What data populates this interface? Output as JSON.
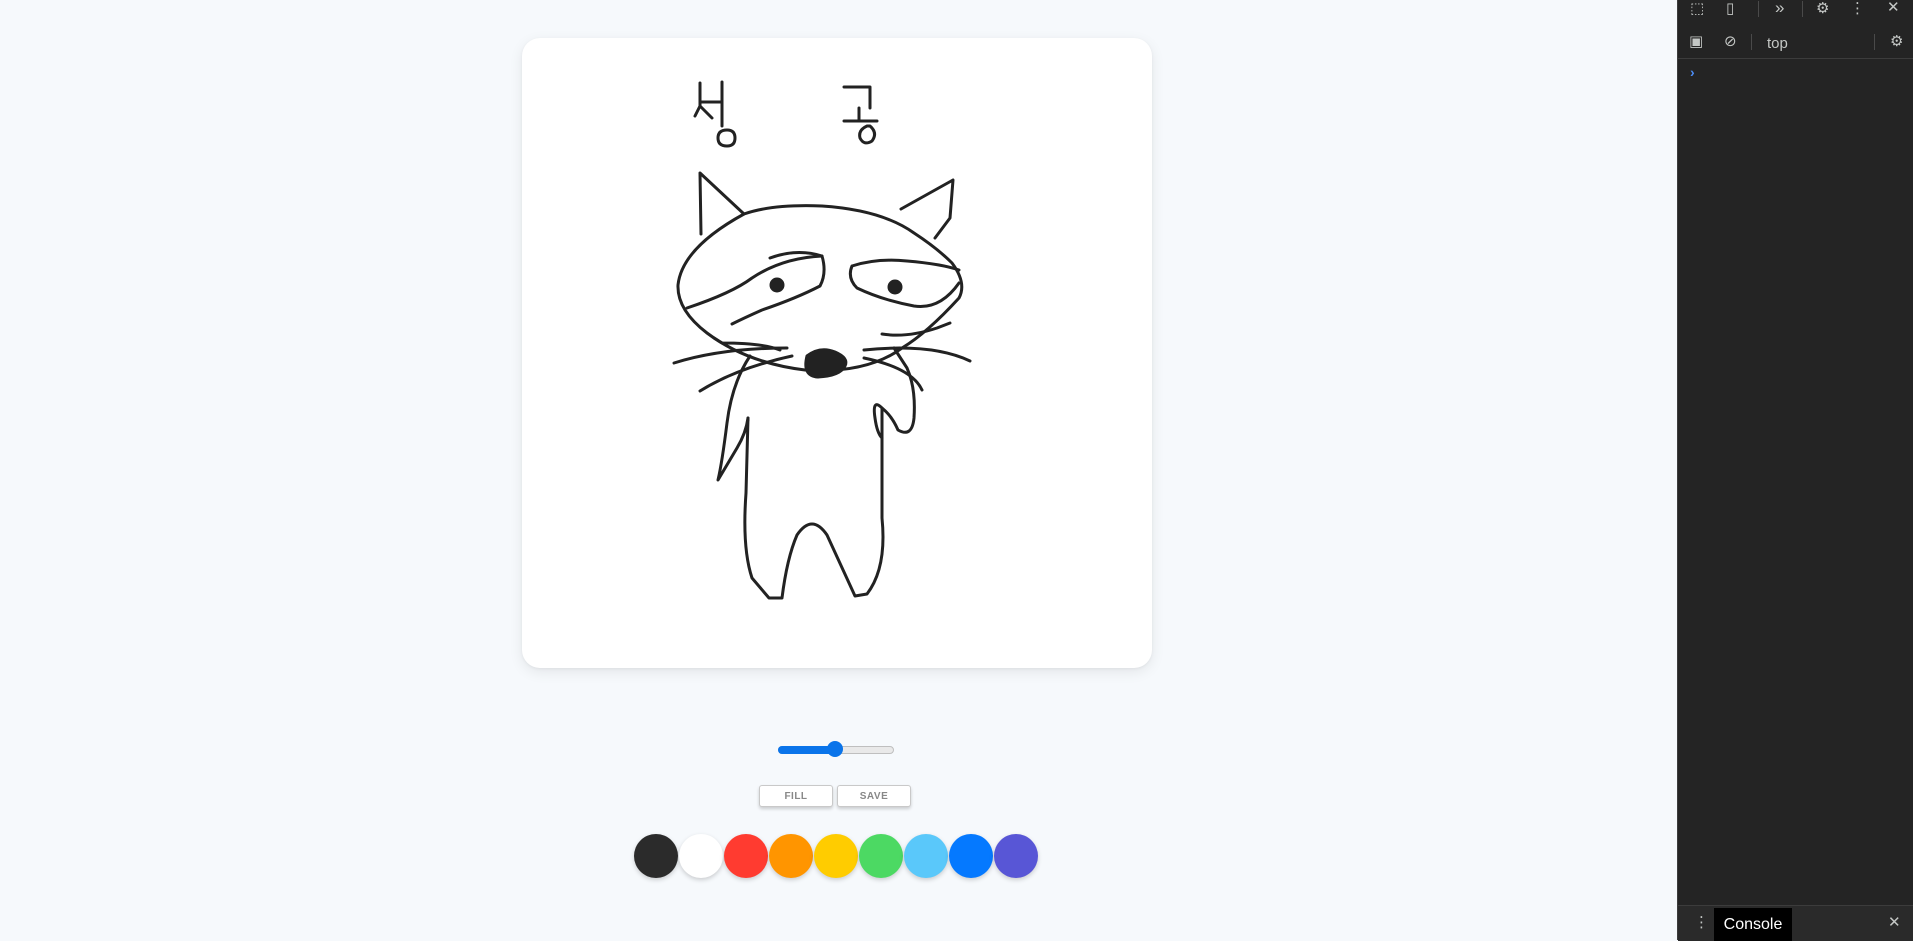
{
  "canvas": {
    "drawing_text": "성   공",
    "stroke_color": "#222222"
  },
  "brush_size": {
    "value": 50,
    "min": 0,
    "max": 100,
    "accent": "#0a74ea"
  },
  "buttons": {
    "fill_label": "FILL",
    "save_label": "SAVE"
  },
  "palette": [
    {
      "name": "black",
      "color": "#2b2b2b"
    },
    {
      "name": "white",
      "color": "#ffffff"
    },
    {
      "name": "red",
      "color": "#ff3b30"
    },
    {
      "name": "orange",
      "color": "#ff9500"
    },
    {
      "name": "yellow",
      "color": "#ffcc00"
    },
    {
      "name": "green",
      "color": "#4cd963"
    },
    {
      "name": "light-blue",
      "color": "#5ac8fa"
    },
    {
      "name": "blue",
      "color": "#0579ff"
    },
    {
      "name": "purple",
      "color": "#5856d6"
    }
  ],
  "devtools": {
    "context_label": "top",
    "drawer_tab": "Console",
    "icons": [
      "inspect-icon",
      "device-toggle-icon",
      "more-tabs-icon",
      "settings-icon",
      "kebab-menu-icon",
      "close-icon",
      "sidebar-toggle-icon",
      "clear-console-icon",
      "console-settings-icon"
    ]
  }
}
